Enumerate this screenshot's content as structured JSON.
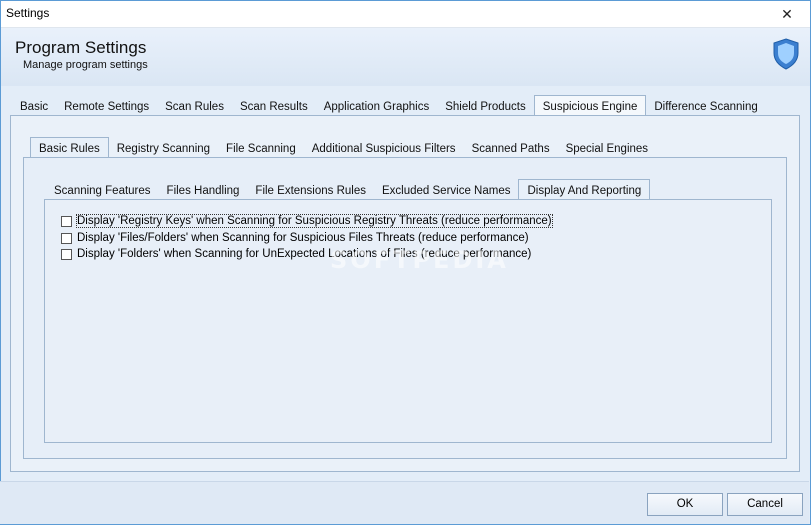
{
  "window": {
    "title": "Settings",
    "close_glyph": "✕"
  },
  "header": {
    "title": "Program Settings",
    "subtitle": "Manage program settings",
    "icon": "shield-icon"
  },
  "main_tabs": [
    {
      "label": "Basic"
    },
    {
      "label": "Remote Settings"
    },
    {
      "label": "Scan Rules"
    },
    {
      "label": "Scan Results"
    },
    {
      "label": "Application Graphics"
    },
    {
      "label": "Shield Products"
    },
    {
      "label": "Suspicious Engine",
      "active": true
    },
    {
      "label": "Difference Scanning"
    }
  ],
  "sub_tabs": [
    {
      "label": "Basic Rules",
      "active": true
    },
    {
      "label": "Registry Scanning"
    },
    {
      "label": "File Scanning"
    },
    {
      "label": "Additional Suspicious Filters"
    },
    {
      "label": "Scanned Paths"
    },
    {
      "label": "Special Engines"
    }
  ],
  "inner_tabs": [
    {
      "label": "Scanning Features"
    },
    {
      "label": "Files Handling"
    },
    {
      "label": "File Extensions Rules"
    },
    {
      "label": "Excluded Service Names"
    },
    {
      "label": "Display And Reporting",
      "active": true
    }
  ],
  "options": [
    {
      "label": "Display 'Registry Keys' when Scanning for Suspicious Registry Threats (reduce performance)",
      "checked": false
    },
    {
      "label": "Display 'Files/Folders' when Scanning for Suspicious Files Threats (reduce performance)",
      "checked": false
    },
    {
      "label": "Display 'Folders' when Scanning for UnExpected Locations of Files (reduce performance)",
      "checked": false
    }
  ],
  "watermark": "SOFTPEDIA",
  "footer": {
    "ok_label": "OK",
    "cancel_label": "Cancel"
  },
  "colors": {
    "accent": "#5b9bd5",
    "shield_fill": "#3b7fd0"
  }
}
